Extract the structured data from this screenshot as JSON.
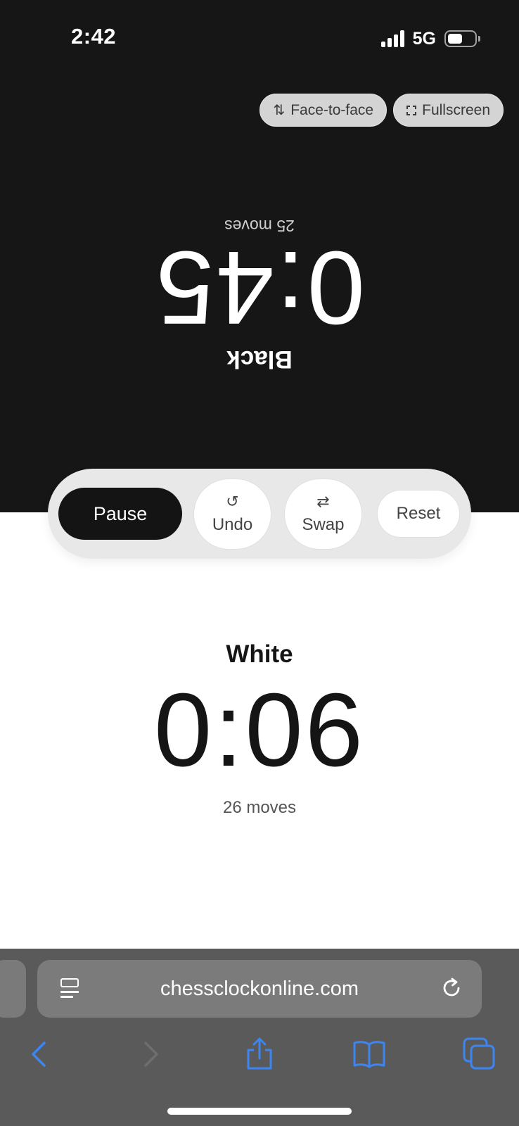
{
  "status_bar": {
    "time": "2:42",
    "network": "5G"
  },
  "top_buttons": {
    "face_to_face": {
      "label": "Face-to-face",
      "icon": "swap-vertical-icon"
    },
    "fullscreen": {
      "label": "Fullscreen",
      "icon": "fullscreen-icon"
    }
  },
  "black_player": {
    "name": "Black",
    "time": "0:45",
    "moves": "25 moves"
  },
  "controls": {
    "pause": "Pause",
    "undo": {
      "label": "Undo",
      "icon": "undo-icon"
    },
    "swap": {
      "label": "Swap",
      "icon": "swap-horizontal-icon"
    },
    "reset": "Reset"
  },
  "white_player": {
    "name": "White",
    "time": "0:06",
    "moves": "26 moves"
  },
  "browser": {
    "url": "chessclockonline.com",
    "accent_color": "#3d86f2",
    "nav_icons": [
      "back-icon",
      "forward-icon",
      "share-icon",
      "bookmarks-icon",
      "tabs-icon"
    ]
  },
  "colors": {
    "dark_half": "#161616",
    "light_half": "#ffffff",
    "control_bar": "#e8e8e8",
    "chrome": "#5a5a5a"
  }
}
